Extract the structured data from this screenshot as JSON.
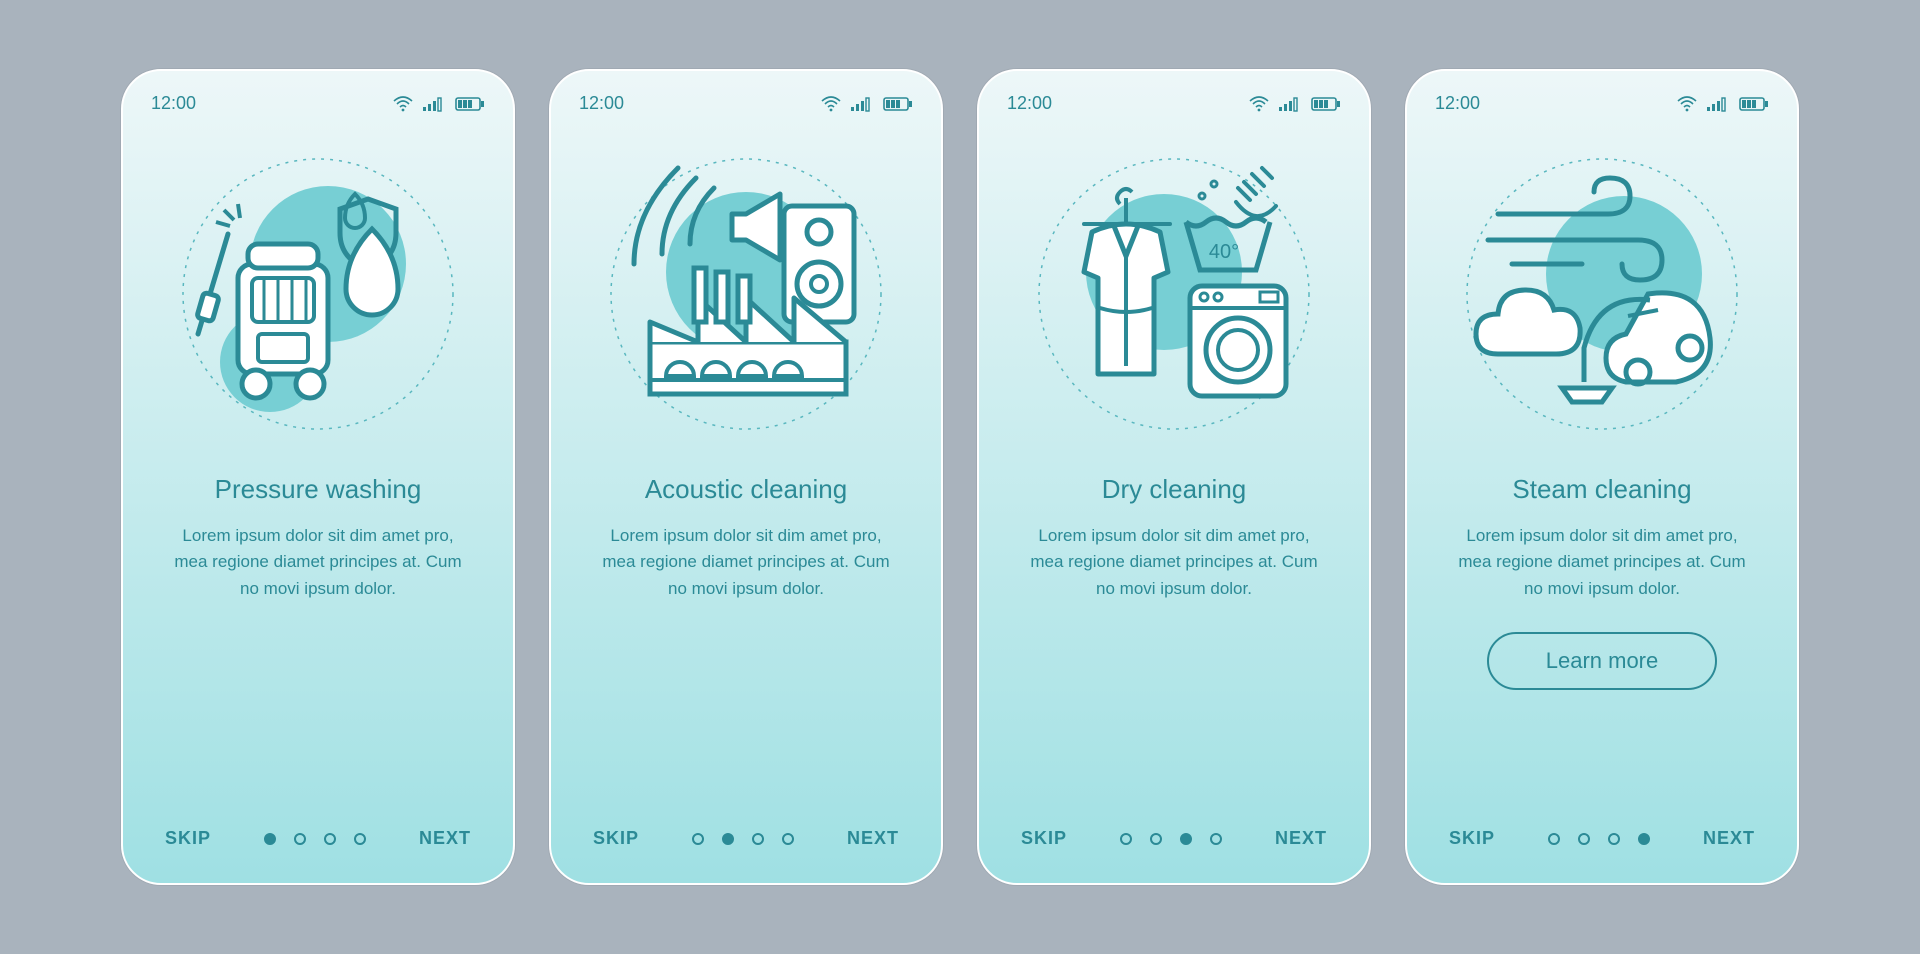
{
  "status": {
    "time": "12:00"
  },
  "nav": {
    "skip": "SKIP",
    "next": "NEXT",
    "total": 4
  },
  "core": {
    "body": "Lorem ipsum dolor sit dim amet pro, mea regione diamet principes at. Cum no movi ipsum dolor.",
    "learn": "Learn more"
  },
  "screens": [
    {
      "title": "Pressure washing",
      "active": 0,
      "cta": false,
      "icon": "pressure-washing-icon"
    },
    {
      "title": "Acoustic cleaning",
      "active": 1,
      "cta": false,
      "icon": "acoustic-cleaning-icon"
    },
    {
      "title": "Dry cleaning",
      "active": 2,
      "cta": false,
      "icon": "dry-cleaning-icon"
    },
    {
      "title": "Steam cleaning",
      "active": 3,
      "cta": true,
      "icon": "steam-cleaning-icon"
    }
  ]
}
